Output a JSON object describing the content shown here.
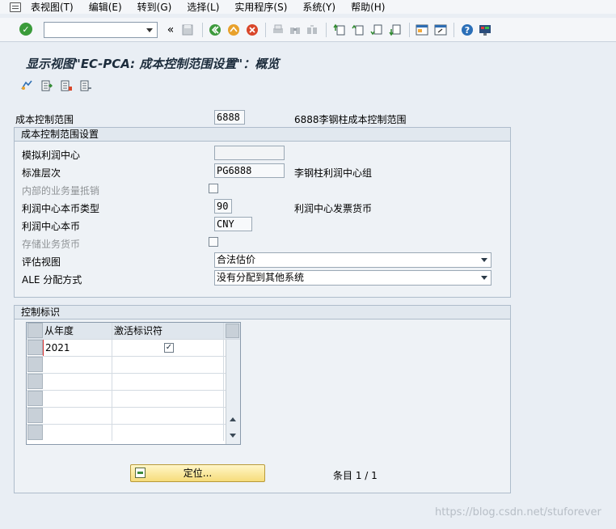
{
  "menu": {
    "items": [
      "表视图(T)",
      "编辑(E)",
      "转到(G)",
      "选择(L)",
      "实用程序(S)",
      "系统(Y)",
      "帮助(H)"
    ]
  },
  "toolbar": {
    "command_value": "",
    "back_symbol": "«"
  },
  "title": "显示视图\"EC-PCA: 成本控制范围设置\"：概览",
  "header": {
    "controlling_area_label": "成本控制范围",
    "controlling_area_value": "6888",
    "controlling_area_desc": "6888李钢柱成本控制范围"
  },
  "settings_group": {
    "title": "成本控制范围设置",
    "dummy_pc_label": "模拟利润中心",
    "dummy_pc_value": "",
    "std_hierarchy_label": "标准层次",
    "std_hierarchy_value": "PG6888",
    "std_hierarchy_desc": "李钢柱利润中心组",
    "internal_volume_label": "内部的业务量抵销",
    "pc_curr_type_label": "利润中心本币类型",
    "pc_curr_type_value": "90",
    "pc_curr_type_desc": "利润中心发票货币",
    "pc_currency_label": "利润中心本币",
    "pc_currency_value": "CNY",
    "store_txn_curr_label": "存储业务货币",
    "valuation_view_label": "评估视图",
    "valuation_view_value": "合法估价",
    "ale_method_label": "ALE 分配方式",
    "ale_method_value": "没有分配到其他系统"
  },
  "control_group": {
    "title": "控制标识",
    "col_from_year": "从年度",
    "col_active": "激活标识符",
    "rows": [
      {
        "year": "2021",
        "active": true
      }
    ],
    "checkmark": "✓"
  },
  "position_button": "定位...",
  "entry_counter": "条目 1 / 1",
  "watermark": "https://blog.csdn.net/stuforever"
}
